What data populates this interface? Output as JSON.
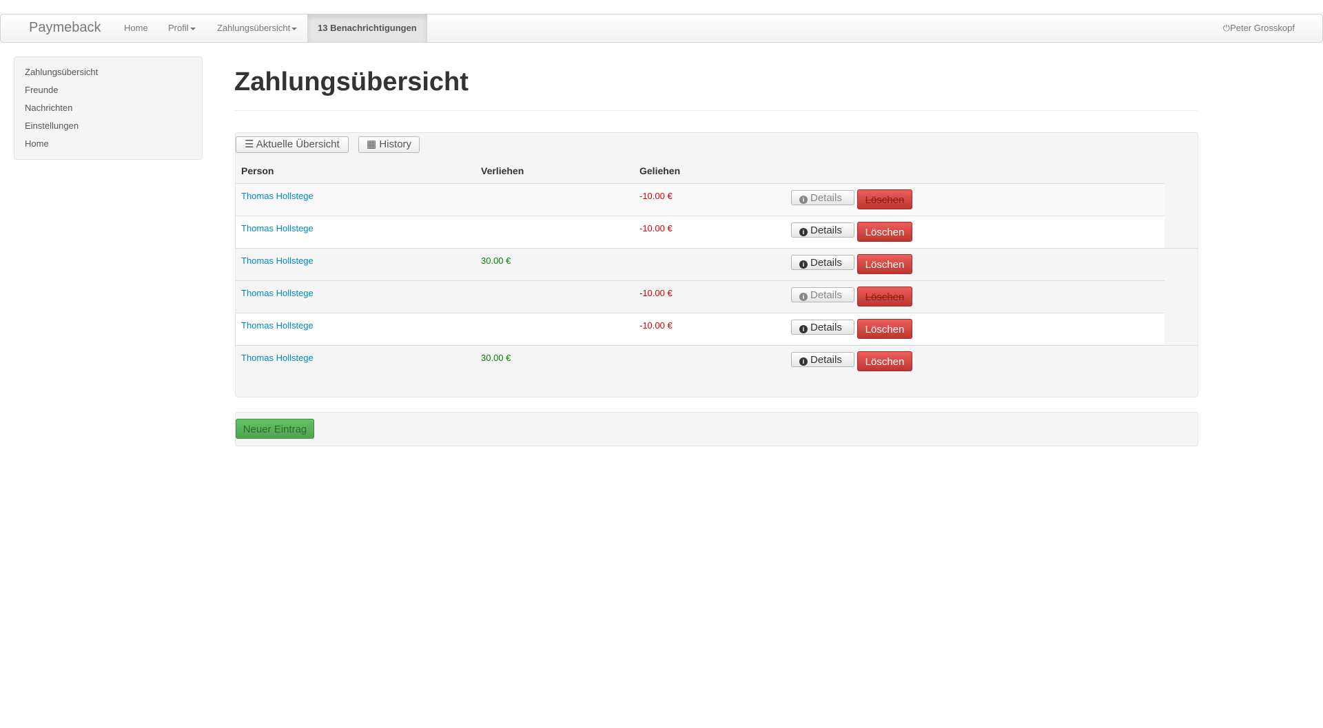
{
  "navbar": {
    "brand": "Paymeback",
    "items": [
      {
        "label": "Home"
      },
      {
        "label": "Profil"
      },
      {
        "label": "Zahlungsübersicht"
      },
      {
        "label": "13 Benachrichtigungen"
      }
    ],
    "user": "Peter Grosskopf"
  },
  "sidebar": {
    "items": [
      {
        "label": "Zahlungsübersicht"
      },
      {
        "label": "Freunde"
      },
      {
        "label": "Nachrichten"
      },
      {
        "label": "Einstellungen"
      },
      {
        "label": "Home"
      }
    ]
  },
  "page": {
    "title": "Zahlungsübersicht"
  },
  "tabs": [
    {
      "label": "Aktuelle Übersicht",
      "icon": "list-icon"
    },
    {
      "label": "History",
      "icon": "calendar-icon"
    }
  ],
  "table": {
    "headers": [
      "Person",
      "Verliehen",
      "Geliehen"
    ],
    "details_label": "Details",
    "delete_label": "Löschen",
    "rows": [
      {
        "person": "Thomas Hollstege",
        "verliehen": "",
        "geliehen": "-10.00 €"
      },
      {
        "person": "Thomas Hollstege",
        "verliehen": "",
        "geliehen": "-10.00 €"
      },
      {
        "person": "Thomas Hollstege",
        "verliehen": "30.00 €",
        "geliehen": ""
      },
      {
        "person": "Thomas Hollstege",
        "verliehen": "",
        "geliehen": "-10.00 €"
      },
      {
        "person": "Thomas Hollstege",
        "verliehen": "",
        "geliehen": "-10.00 €"
      },
      {
        "person": "Thomas Hollstege",
        "verliehen": "30.00 €",
        "geliehen": ""
      }
    ]
  },
  "footer": {
    "new_entry_label": "Neuer Eintrag"
  },
  "colors": {
    "link": "#0088cc",
    "negative": "#dd0000",
    "positive": "#008000",
    "danger": "#da4f49",
    "success": "#5bb75b"
  }
}
